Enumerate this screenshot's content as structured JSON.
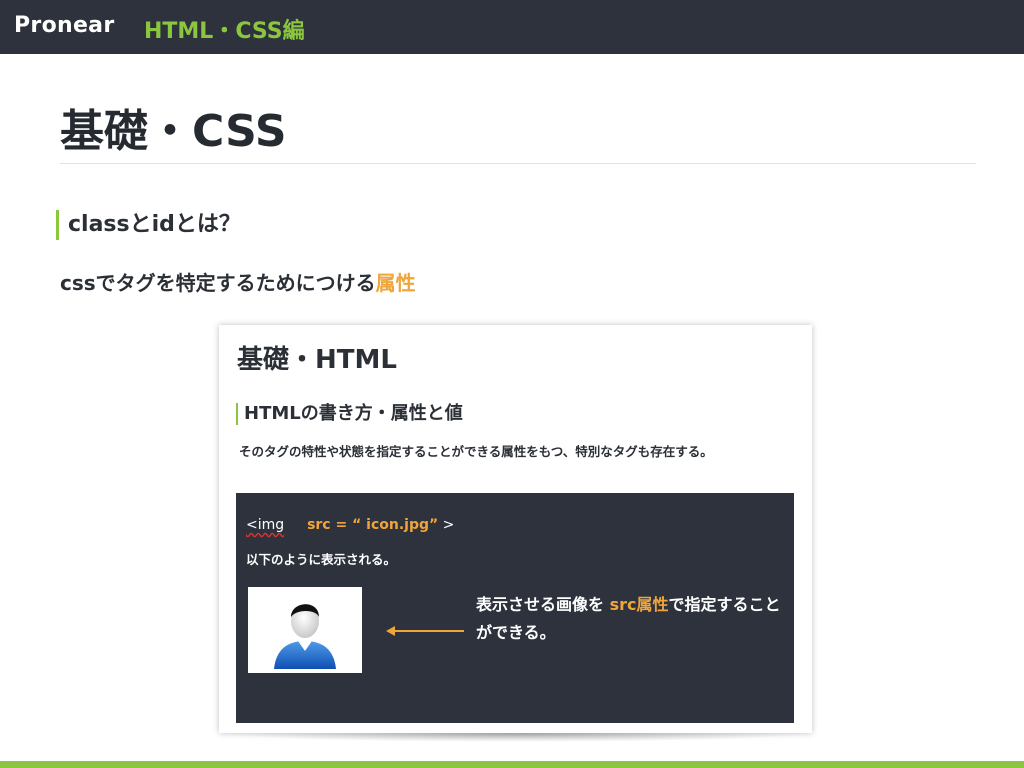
{
  "header": {
    "brand": "Pronear",
    "section": "HTML・CSS編"
  },
  "main": {
    "title": "基礎・CSS",
    "subheading": "classとidとは？",
    "description_prefix": "cssでタグを特定するためにつける",
    "description_highlight": "属性"
  },
  "slide_image": {
    "title": "基礎・HTML",
    "subheading": "HTMLの書き方・属性と値",
    "description": "そのタグの特性や状態を指定することができる属性をもつ、特別なタグも存在する。",
    "code_tag": "<img",
    "code_attr": "src = “ icon.jpg”",
    "code_close": ">",
    "note": "以下のように表示される。",
    "explain_prefix": "表示させる画像を ",
    "explain_highlight": "src属性",
    "explain_suffix": "で指定することができる。"
  },
  "colors": {
    "header_bg": "#2d323c",
    "accent_green": "#8cc63f",
    "accent_orange": "#f0a53a",
    "text": "#2b2f36"
  },
  "icons": {
    "avatar": "user-silhouette-icon",
    "arrow": "left-arrow-icon"
  }
}
